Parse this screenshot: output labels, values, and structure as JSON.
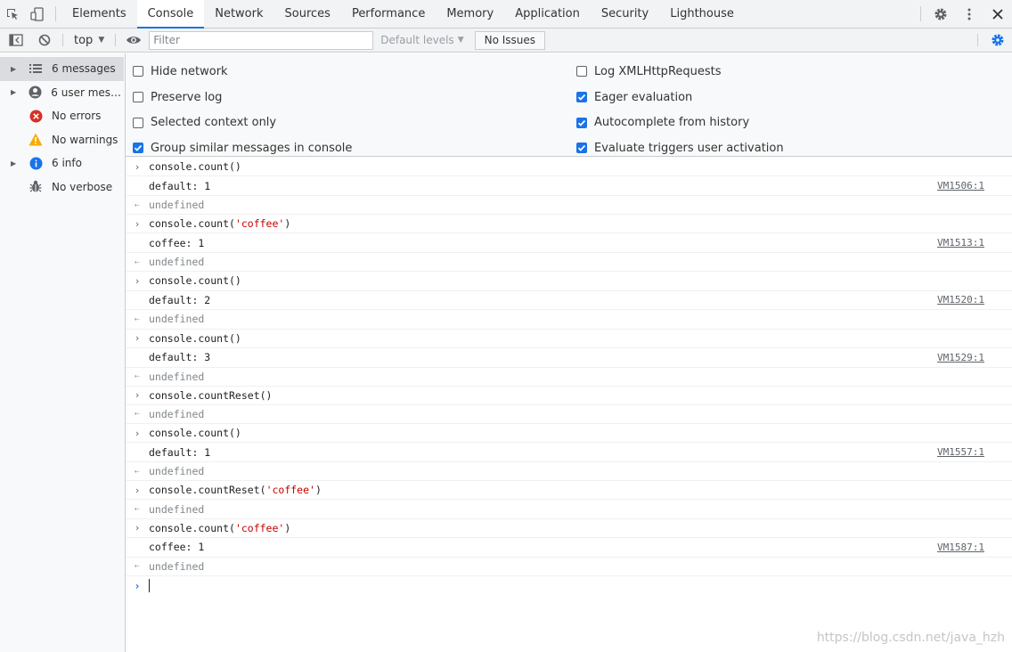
{
  "tabs": [
    {
      "label": "Elements",
      "active": false
    },
    {
      "label": "Console",
      "active": true
    },
    {
      "label": "Network",
      "active": false
    },
    {
      "label": "Sources",
      "active": false
    },
    {
      "label": "Performance",
      "active": false
    },
    {
      "label": "Memory",
      "active": false
    },
    {
      "label": "Application",
      "active": false
    },
    {
      "label": "Security",
      "active": false
    },
    {
      "label": "Lighthouse",
      "active": false
    }
  ],
  "toolbar": {
    "context": "top",
    "filter_placeholder": "Filter",
    "filter_value": "",
    "levels": "Default levels",
    "issues": "No Issues"
  },
  "sidebar": {
    "items": [
      {
        "label": "6 messages",
        "icon": "list-icon",
        "expandable": true,
        "selected": true
      },
      {
        "label": "6 user mess…",
        "icon": "user-icon",
        "expandable": true,
        "selected": false
      },
      {
        "label": "No errors",
        "icon": "error-icon",
        "expandable": false,
        "selected": false
      },
      {
        "label": "No warnings",
        "icon": "warning-icon",
        "expandable": false,
        "selected": false
      },
      {
        "label": "6 info",
        "icon": "info-icon",
        "expandable": true,
        "selected": false
      },
      {
        "label": "No verbose",
        "icon": "bug-icon",
        "expandable": false,
        "selected": false
      }
    ]
  },
  "settings": {
    "left": [
      {
        "label": "Hide network",
        "checked": false
      },
      {
        "label": "Preserve log",
        "checked": false
      },
      {
        "label": "Selected context only",
        "checked": false
      },
      {
        "label": "Group similar messages in console",
        "checked": true
      }
    ],
    "right": [
      {
        "label": "Log XMLHttpRequests",
        "checked": false
      },
      {
        "label": "Eager evaluation",
        "checked": true
      },
      {
        "label": "Autocomplete from history",
        "checked": true
      },
      {
        "label": "Evaluate triggers user activation",
        "checked": true
      }
    ]
  },
  "console": [
    {
      "kind": "in",
      "parts": [
        {
          "t": "console.count()"
        }
      ]
    },
    {
      "kind": "log",
      "parts": [
        {
          "t": "default: 1"
        }
      ],
      "source": "VM1506:1"
    },
    {
      "kind": "out",
      "parts": [
        {
          "t": "undefined"
        }
      ]
    },
    {
      "kind": "in",
      "parts": [
        {
          "t": "console.count("
        },
        {
          "t": "'coffee'",
          "s": true
        },
        {
          "t": ")"
        }
      ]
    },
    {
      "kind": "log",
      "parts": [
        {
          "t": "coffee: 1"
        }
      ],
      "source": "VM1513:1"
    },
    {
      "kind": "out",
      "parts": [
        {
          "t": "undefined"
        }
      ]
    },
    {
      "kind": "in",
      "parts": [
        {
          "t": "console.count()"
        }
      ]
    },
    {
      "kind": "log",
      "parts": [
        {
          "t": "default: 2"
        }
      ],
      "source": "VM1520:1"
    },
    {
      "kind": "out",
      "parts": [
        {
          "t": "undefined"
        }
      ]
    },
    {
      "kind": "in",
      "parts": [
        {
          "t": "console.count()"
        }
      ]
    },
    {
      "kind": "log",
      "parts": [
        {
          "t": "default: 3"
        }
      ],
      "source": "VM1529:1"
    },
    {
      "kind": "out",
      "parts": [
        {
          "t": "undefined"
        }
      ]
    },
    {
      "kind": "in",
      "parts": [
        {
          "t": "console.countReset()"
        }
      ]
    },
    {
      "kind": "out",
      "parts": [
        {
          "t": "undefined"
        }
      ]
    },
    {
      "kind": "in",
      "parts": [
        {
          "t": "console.count()"
        }
      ]
    },
    {
      "kind": "log",
      "parts": [
        {
          "t": "default: 1"
        }
      ],
      "source": "VM1557:1"
    },
    {
      "kind": "out",
      "parts": [
        {
          "t": "undefined"
        }
      ]
    },
    {
      "kind": "in",
      "parts": [
        {
          "t": "console.countReset("
        },
        {
          "t": "'coffee'",
          "s": true
        },
        {
          "t": ")"
        }
      ]
    },
    {
      "kind": "out",
      "parts": [
        {
          "t": "undefined"
        }
      ]
    },
    {
      "kind": "in",
      "parts": [
        {
          "t": "console.count("
        },
        {
          "t": "'coffee'",
          "s": true
        },
        {
          "t": ")"
        }
      ]
    },
    {
      "kind": "log",
      "parts": [
        {
          "t": "coffee: 1"
        }
      ],
      "source": "VM1587:1"
    },
    {
      "kind": "out",
      "parts": [
        {
          "t": "undefined"
        }
      ]
    }
  ],
  "watermark": "https://blog.csdn.net/java_hzh",
  "colors": {
    "accent": "#1a73e8",
    "string": "#c80000",
    "error": "#d93025",
    "warning": "#f9ab00"
  }
}
